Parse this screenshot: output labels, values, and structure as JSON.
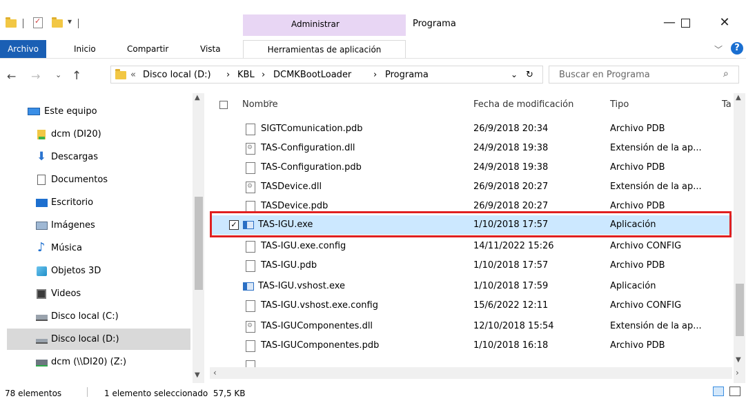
{
  "titlebar": {
    "contextual_group": "Administrar",
    "window_title": "Programa"
  },
  "ribbon": {
    "tabs": [
      "Archivo",
      "Inicio",
      "Compartir",
      "Vista",
      "Herramientas de aplicación"
    ]
  },
  "address": {
    "crumbs": [
      "Disco local (D:)",
      "KBL",
      "DCMKBootLoader",
      "Programa"
    ],
    "search_placeholder": "Buscar en Programa"
  },
  "nav": {
    "items": [
      {
        "label": "Este equipo",
        "icon": "computer-icon"
      },
      {
        "label": "dcm (DI20)",
        "icon": "user-folder-icon"
      },
      {
        "label": "Descargas",
        "icon": "download-icon"
      },
      {
        "label": "Documentos",
        "icon": "documents-icon"
      },
      {
        "label": "Escritorio",
        "icon": "desktop-icon"
      },
      {
        "label": "Imágenes",
        "icon": "pictures-icon"
      },
      {
        "label": "Música",
        "icon": "music-icon"
      },
      {
        "label": "Objetos 3D",
        "icon": "3d-objects-icon"
      },
      {
        "label": "Videos",
        "icon": "videos-icon"
      },
      {
        "label": "Disco local (C:)",
        "icon": "drive-icon"
      },
      {
        "label": "Disco local (D:)",
        "icon": "drive-icon"
      },
      {
        "label": "dcm (\\\\DI20) (Z:)",
        "icon": "network-drive-icon"
      }
    ],
    "selected_index": 10
  },
  "list": {
    "columns": [
      "Nombre",
      "Fecha de modificación",
      "Tipo",
      "Ta"
    ],
    "rows": [
      {
        "name": "SIGTComunication.pdb",
        "date": "26/9/2018 20:34",
        "type": "Archivo PDB",
        "icon": "file-icon"
      },
      {
        "name": "TAS-Configuration.dll",
        "date": "24/9/2018 19:38",
        "type": "Extensión de la ap...",
        "icon": "dll-icon"
      },
      {
        "name": "TAS-Configuration.pdb",
        "date": "24/9/2018 19:38",
        "type": "Archivo PDB",
        "icon": "file-icon"
      },
      {
        "name": "TASDevice.dll",
        "date": "26/9/2018 20:27",
        "type": "Extensión de la ap...",
        "icon": "dll-icon"
      },
      {
        "name": "TASDevice.pdb",
        "date": "26/9/2018 20:27",
        "type": "Archivo PDB",
        "icon": "file-icon"
      },
      {
        "name": "TAS-IGU.exe",
        "date": "1/10/2018 17:57",
        "type": "Aplicación",
        "icon": "app-icon"
      },
      {
        "name": "TAS-IGU.exe.config",
        "date": "14/11/2022 15:26",
        "type": "Archivo CONFIG",
        "icon": "file-icon"
      },
      {
        "name": "TAS-IGU.pdb",
        "date": "1/10/2018 17:57",
        "type": "Archivo PDB",
        "icon": "file-icon"
      },
      {
        "name": "TAS-IGU.vshost.exe",
        "date": "1/10/2018 17:59",
        "type": "Aplicación",
        "icon": "app-icon"
      },
      {
        "name": "TAS-IGU.vshost.exe.config",
        "date": "15/6/2022 12:11",
        "type": "Archivo CONFIG",
        "icon": "file-icon"
      },
      {
        "name": "TAS-IGUComponentes.dll",
        "date": "12/10/2018 15:54",
        "type": "Extensión de la ap...",
        "icon": "dll-icon"
      },
      {
        "name": "TAS-IGUComponentes.pdb",
        "date": "1/10/2018 16:18",
        "type": "Archivo PDB",
        "icon": "file-icon"
      }
    ],
    "selected_index": 5
  },
  "status": {
    "count": "78 elementos",
    "selection": "1 elemento seleccionado  57,5 KB"
  },
  "colors": {
    "accent": "#1a5fb4",
    "context_band": "#e8d6f4",
    "selection": "#cce8ff",
    "highlight_box": "#e02020"
  }
}
